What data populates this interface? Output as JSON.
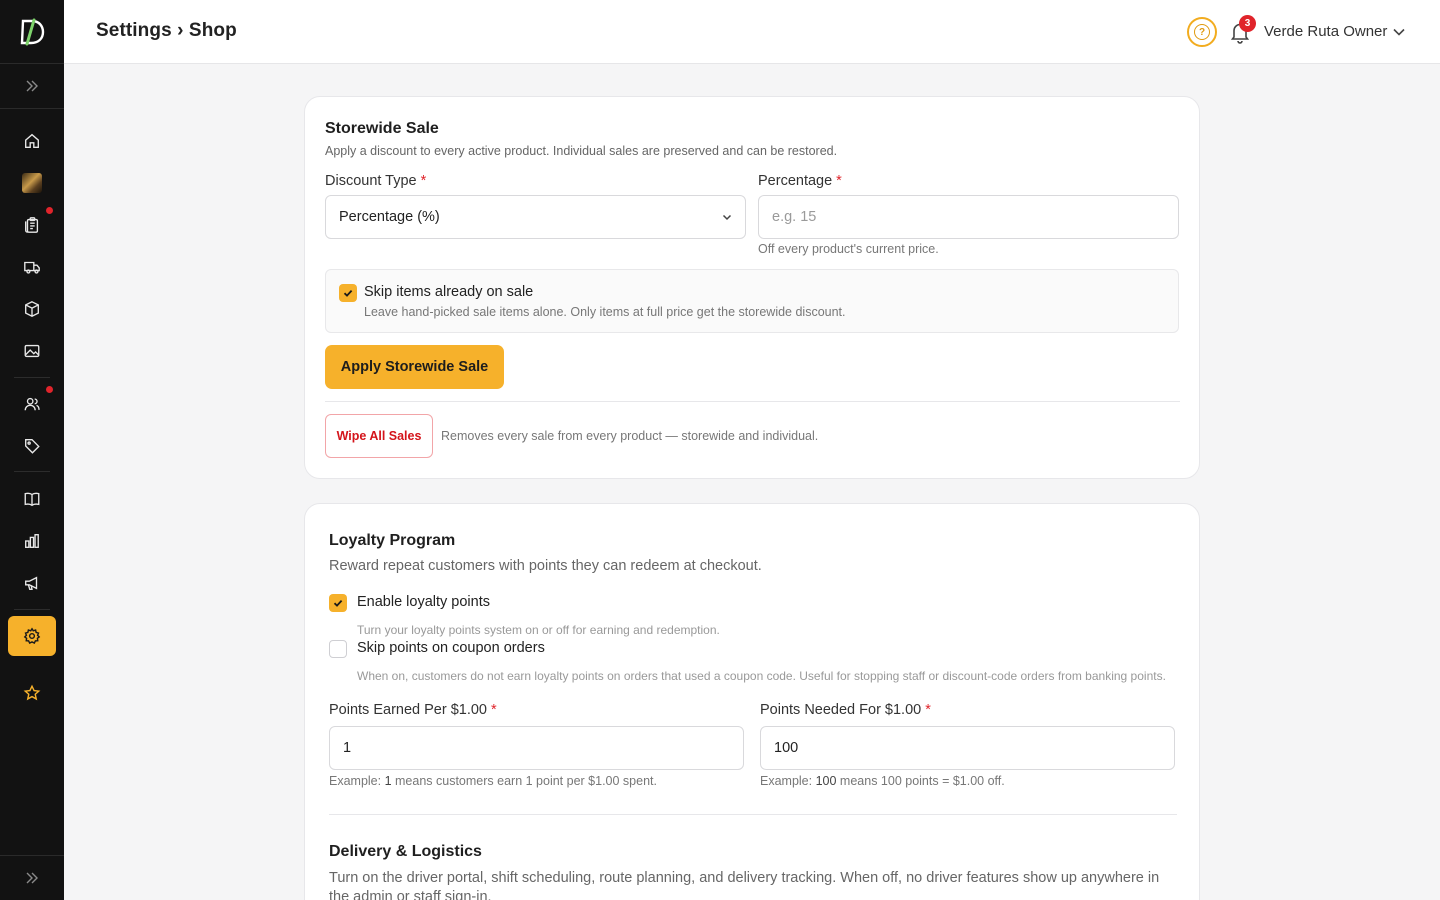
{
  "app": {
    "logo_letter": "D"
  },
  "sidebar": {
    "items": [
      {
        "name": "home-icon"
      },
      {
        "name": "product-thumbnail"
      },
      {
        "name": "orders-icon",
        "dot": true
      },
      {
        "name": "delivery-truck-icon"
      },
      {
        "name": "box-icon"
      },
      {
        "name": "image-icon"
      },
      {
        "name": "customers-icon",
        "dot": true
      },
      {
        "name": "tag-icon"
      },
      {
        "name": "book-icon"
      },
      {
        "name": "chart-icon"
      },
      {
        "name": "megaphone-icon"
      },
      {
        "name": "gear-icon",
        "active": true
      },
      {
        "name": "star-icon"
      }
    ],
    "colors": {
      "bg": "#121212",
      "active": "#f6b12b",
      "dot": "#e0242b"
    }
  },
  "header": {
    "breadcrumb": "Settings › Shop",
    "notification_count": "3",
    "user_name": "Verde Ruta Owner"
  },
  "storewide_sale": {
    "title": "Storewide Sale",
    "subtitle": "Apply a discount to every active product. Individual sales are preserved and can be restored.",
    "discount_type_label": "Discount Type",
    "discount_type_value": "Percentage (%)",
    "percentage_label": "Percentage",
    "percentage_placeholder": "e.g. 15",
    "percentage_help": "Off every product's current price.",
    "skip_label": "Skip items already on sale",
    "skip_checked": true,
    "skip_help": "Leave hand-picked sale items alone. Only items at full price get the storewide discount.",
    "apply_button": "Apply Storewide Sale",
    "wipe_button": "Wipe All Sales",
    "wipe_help": "Removes every sale from every product — storewide and individual."
  },
  "loyalty": {
    "title": "Loyalty Program",
    "subtitle": "Reward repeat customers with points they can redeem at checkout.",
    "enable_label": "Enable loyalty points",
    "enable_checked": true,
    "enable_help": "Turn your loyalty points system on or off for earning and redemption.",
    "skip_coupon_label": "Skip points on coupon orders",
    "skip_coupon_checked": false,
    "skip_coupon_help": "When on, customers do not earn loyalty points on orders that used a coupon code. Useful for stopping staff or discount-code orders from banking points.",
    "earned_label": "Points Earned Per $1.00",
    "earned_value": "1",
    "earned_help_prefix": "Example: ",
    "earned_help_value": "1",
    "earned_help_suffix": " means customers earn 1 point per $1.00 spent.",
    "needed_label": "Points Needed For $1.00",
    "needed_value": "100",
    "needed_help_prefix": "Example: ",
    "needed_help_value": "100",
    "needed_help_suffix": " means 100 points = $1.00 off."
  },
  "delivery": {
    "title": "Delivery & Logistics",
    "subtitle": "Turn on the driver portal, shift scheduling, route planning, and delivery tracking. When off, no driver features show up anywhere in the admin or staff sign-in."
  },
  "colors": {
    "accent": "#f6b12b",
    "danger": "#d4141b",
    "required": "#e0242b"
  }
}
